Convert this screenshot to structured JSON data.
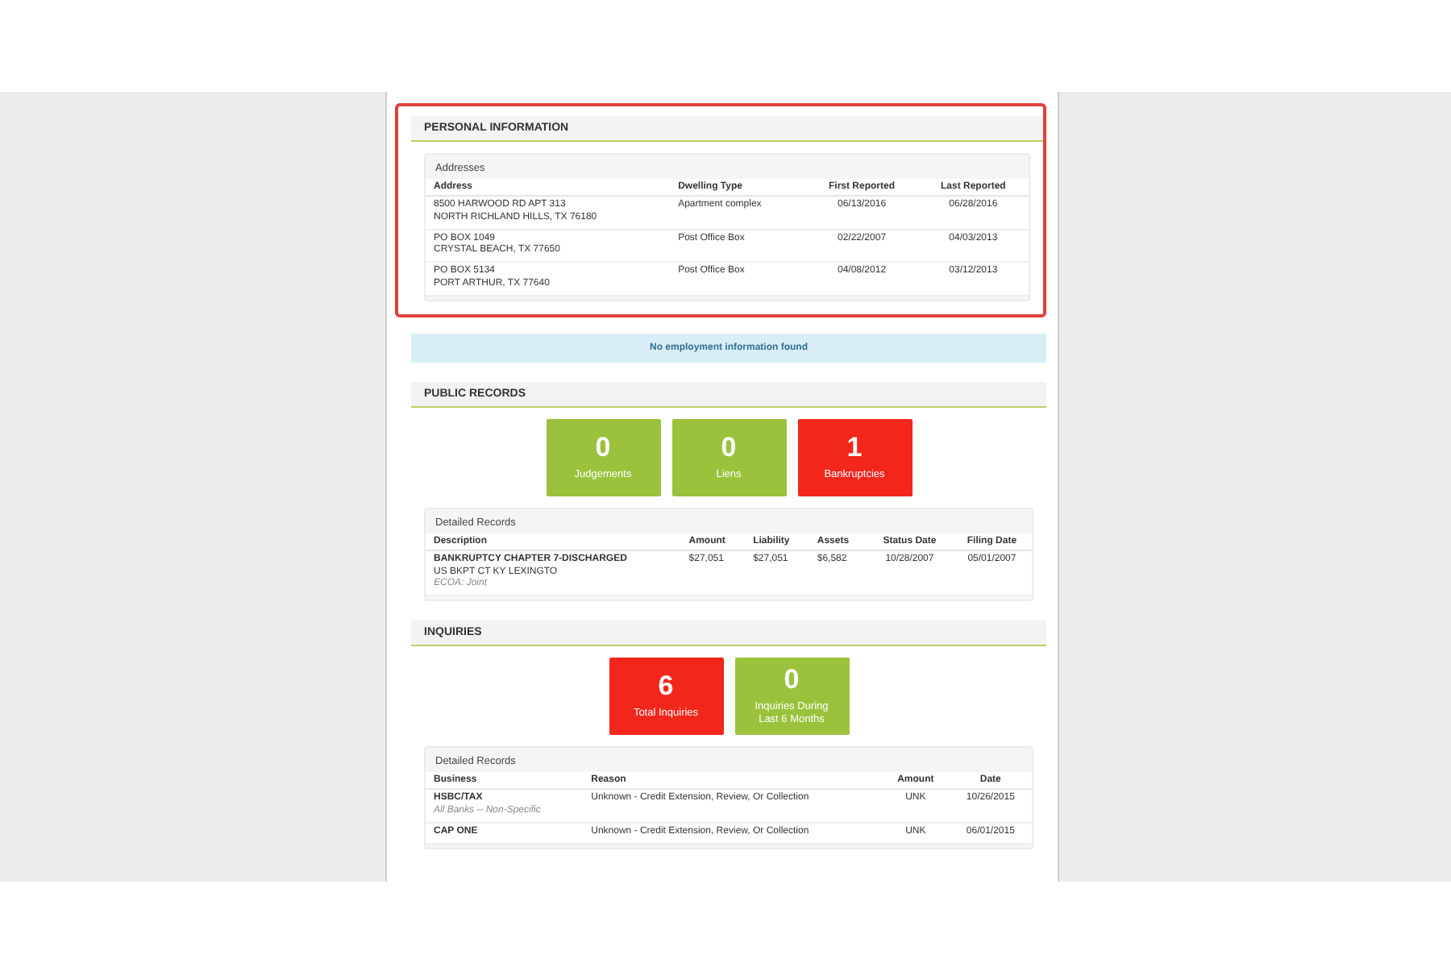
{
  "personal_information": {
    "title": "PERSONAL INFORMATION",
    "highlighted": true,
    "card_title": "Addresses",
    "columns": [
      "Address",
      "Dwelling Type",
      "First Reported",
      "Last Reported"
    ],
    "rows": [
      {
        "address": [
          "8500 HARWOOD RD APT 313",
          "NORTH RICHLAND HILLS, TX 76180"
        ],
        "dwelling_type": "Apartment complex",
        "first_reported": "06/13/2016",
        "last_reported": "06/28/2016"
      },
      {
        "address": [
          "PO BOX 1049",
          "CRYSTAL BEACH, TX 77650"
        ],
        "dwelling_type": "Post Office Box",
        "first_reported": "02/22/2007",
        "last_reported": "04/03/2013"
      },
      {
        "address": [
          "PO BOX 5134",
          "PORT ARTHUR, TX 77640"
        ],
        "dwelling_type": "Post Office Box",
        "first_reported": "04/08/2012",
        "last_reported": "03/12/2013"
      }
    ]
  },
  "employment_notice": "No employment information found",
  "public_records": {
    "title": "PUBLIC RECORDS",
    "tiles": [
      {
        "value": "0",
        "label": "Judgements",
        "color": "#9ac23c"
      },
      {
        "value": "0",
        "label": "Liens",
        "color": "#9ac23c"
      },
      {
        "value": "1",
        "label": "Bankruptcies",
        "color": "#f2261b"
      }
    ],
    "card_title": "Detailed Records",
    "columns": [
      "Description",
      "Amount",
      "Liability",
      "Assets",
      "Status Date",
      "Filing Date"
    ],
    "rows": [
      {
        "description": "BANKRUPTCY CHAPTER 7-DISCHARGED",
        "court": "US BKPT CT KY LEXINGTO",
        "ecoa": "ECOA: Joint",
        "amount": "$27,051",
        "liability": "$27,051",
        "assets": "$6,582",
        "status_date": "10/28/2007",
        "filing_date": "05/01/2007"
      }
    ]
  },
  "inquiries": {
    "title": "INQUIRIES",
    "tiles": [
      {
        "value": "6",
        "label": "Total Inquiries",
        "color": "#f2261b"
      },
      {
        "value": "0",
        "label": "Inquiries During Last 6 Months",
        "color": "#9ac23c"
      }
    ],
    "card_title": "Detailed Records",
    "columns": [
      "Business",
      "Reason",
      "Amount",
      "Date"
    ],
    "rows": [
      {
        "business": "HSBC/TAX",
        "category": "All Banks -- Non-Specific",
        "reason": "Unknown - Credit Extension, Review, Or Collection",
        "amount": "UNK",
        "date": "10/26/2015"
      },
      {
        "business": "CAP ONE",
        "reason": "Unknown - Credit Extension, Review, Or Collection",
        "amount": "UNK",
        "date": "06/01/2015"
      }
    ]
  }
}
